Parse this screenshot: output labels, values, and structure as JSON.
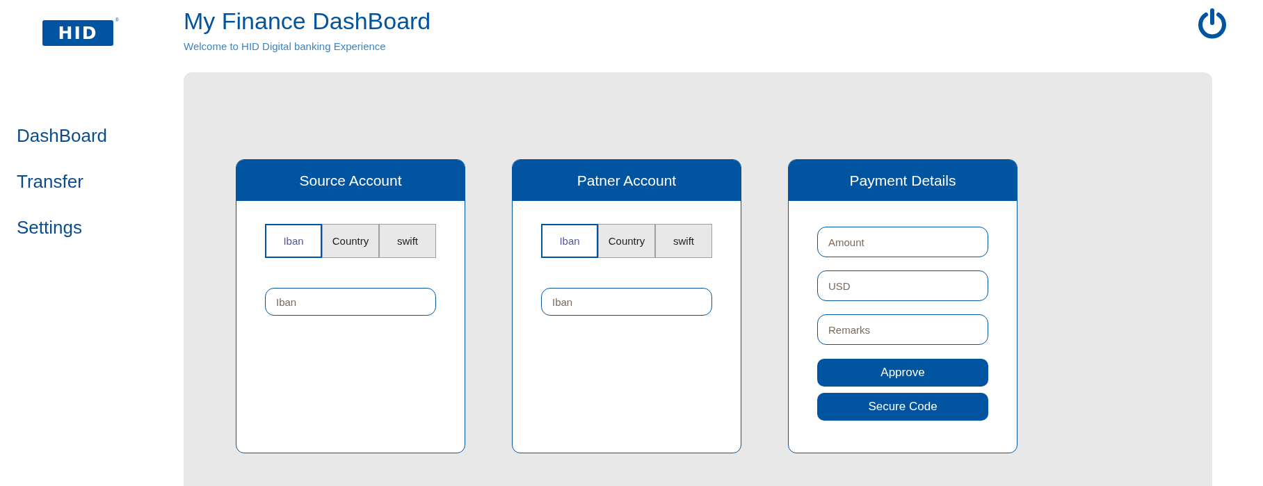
{
  "logo": {
    "text": "HID",
    "mark": "®"
  },
  "header": {
    "title": "My Finance DashBoard",
    "subtitle": "Welcome to HID Digital banking Experience"
  },
  "sidebar": {
    "items": [
      {
        "label": "DashBoard"
      },
      {
        "label": "Transfer"
      },
      {
        "label": "Settings"
      }
    ]
  },
  "cards": [
    {
      "kind": "account",
      "title": "Source Account",
      "tabs": [
        {
          "label": "Iban",
          "selected": true
        },
        {
          "label": "Country",
          "selected": false
        },
        {
          "label": "swift",
          "selected": false
        }
      ],
      "fields": [
        {
          "placeholder": "Iban"
        }
      ]
    },
    {
      "kind": "account",
      "title": "Patner Account",
      "tabs": [
        {
          "label": "Iban",
          "selected": true
        },
        {
          "label": "Country",
          "selected": false
        },
        {
          "label": "swift",
          "selected": false
        }
      ],
      "fields": [
        {
          "placeholder": "Iban"
        }
      ]
    },
    {
      "kind": "payment",
      "title": "Payment Details",
      "fields": [
        {
          "placeholder": "Amount"
        },
        {
          "placeholder": "USD"
        },
        {
          "placeholder": "Remarks"
        }
      ],
      "buttons": [
        "Approve",
        "Secure Code"
      ]
    }
  ]
}
